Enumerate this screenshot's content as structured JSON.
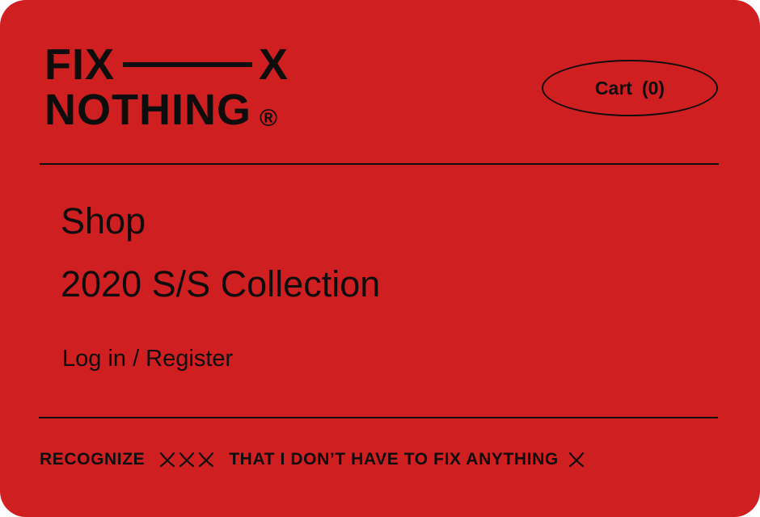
{
  "logo": {
    "line1_left": "FIX",
    "line1_right": "X",
    "line2": "NOTHING",
    "registered_mark": "®"
  },
  "cart": {
    "label": "Cart",
    "count": "(0)"
  },
  "nav": {
    "shop": "Shop",
    "collection": "2020 S/S Collection",
    "login": "Log in / Register"
  },
  "ticker": {
    "part1": "RECOGNIZE",
    "part2": "THAT I DON’T HAVE TO FIX ANYTHING"
  },
  "colors": {
    "background": "#d01f20",
    "ink": "#0d0d0d"
  },
  "icons": [
    "x-mark-icon"
  ]
}
